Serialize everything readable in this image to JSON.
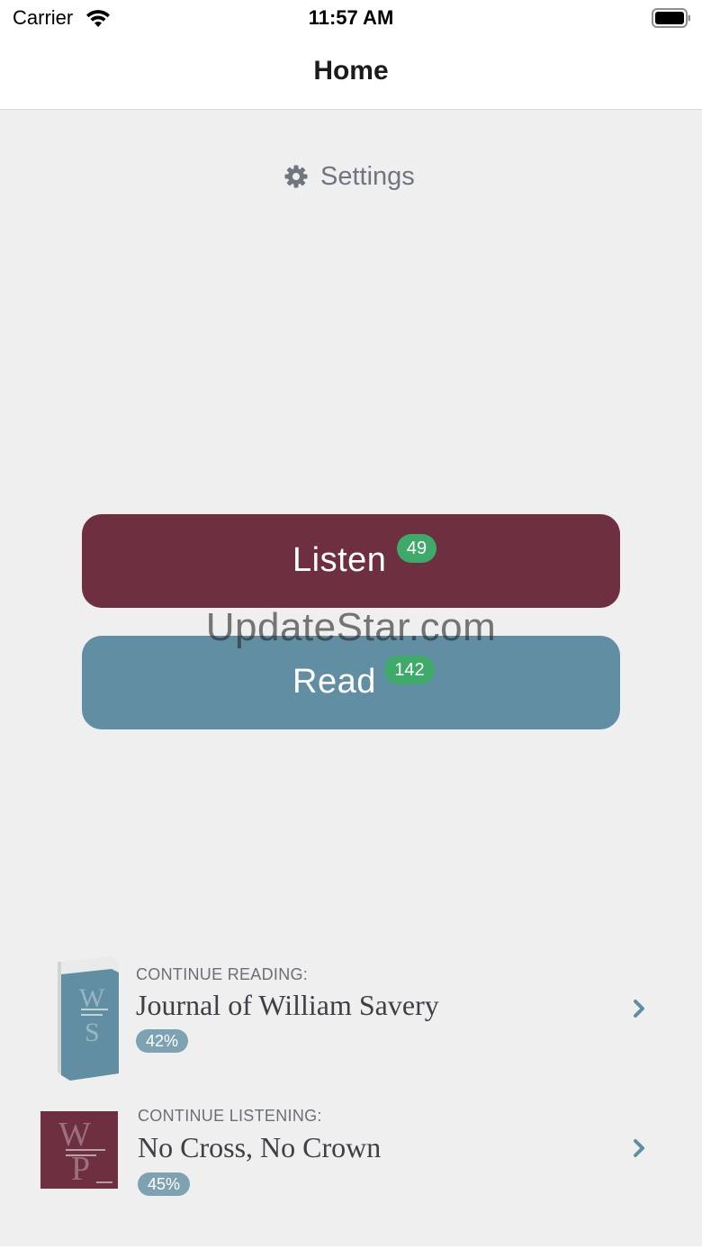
{
  "status_bar": {
    "carrier": "Carrier",
    "time": "11:57 AM"
  },
  "nav": {
    "title": "Home"
  },
  "settings": {
    "label": "Settings",
    "icon": "gear-icon"
  },
  "buttons": {
    "listen": {
      "label": "Listen",
      "count": "49",
      "color": "#6e2f41"
    },
    "read": {
      "label": "Read",
      "count": "142",
      "color": "#618ea2"
    }
  },
  "watermark": "UpdateStar.com",
  "continue_reading": {
    "kicker": "CONTINUE READING:",
    "title": "Journal of William Savery",
    "progress": "42%"
  },
  "continue_listening": {
    "kicker": "CONTINUE LISTENING:",
    "title": "No Cross, No Crown",
    "progress": "45%"
  },
  "colors": {
    "background": "#efeff0",
    "badge_green": "#3fa96a",
    "progress_badge": "#7fa2b3",
    "chevron": "#618ea2"
  }
}
